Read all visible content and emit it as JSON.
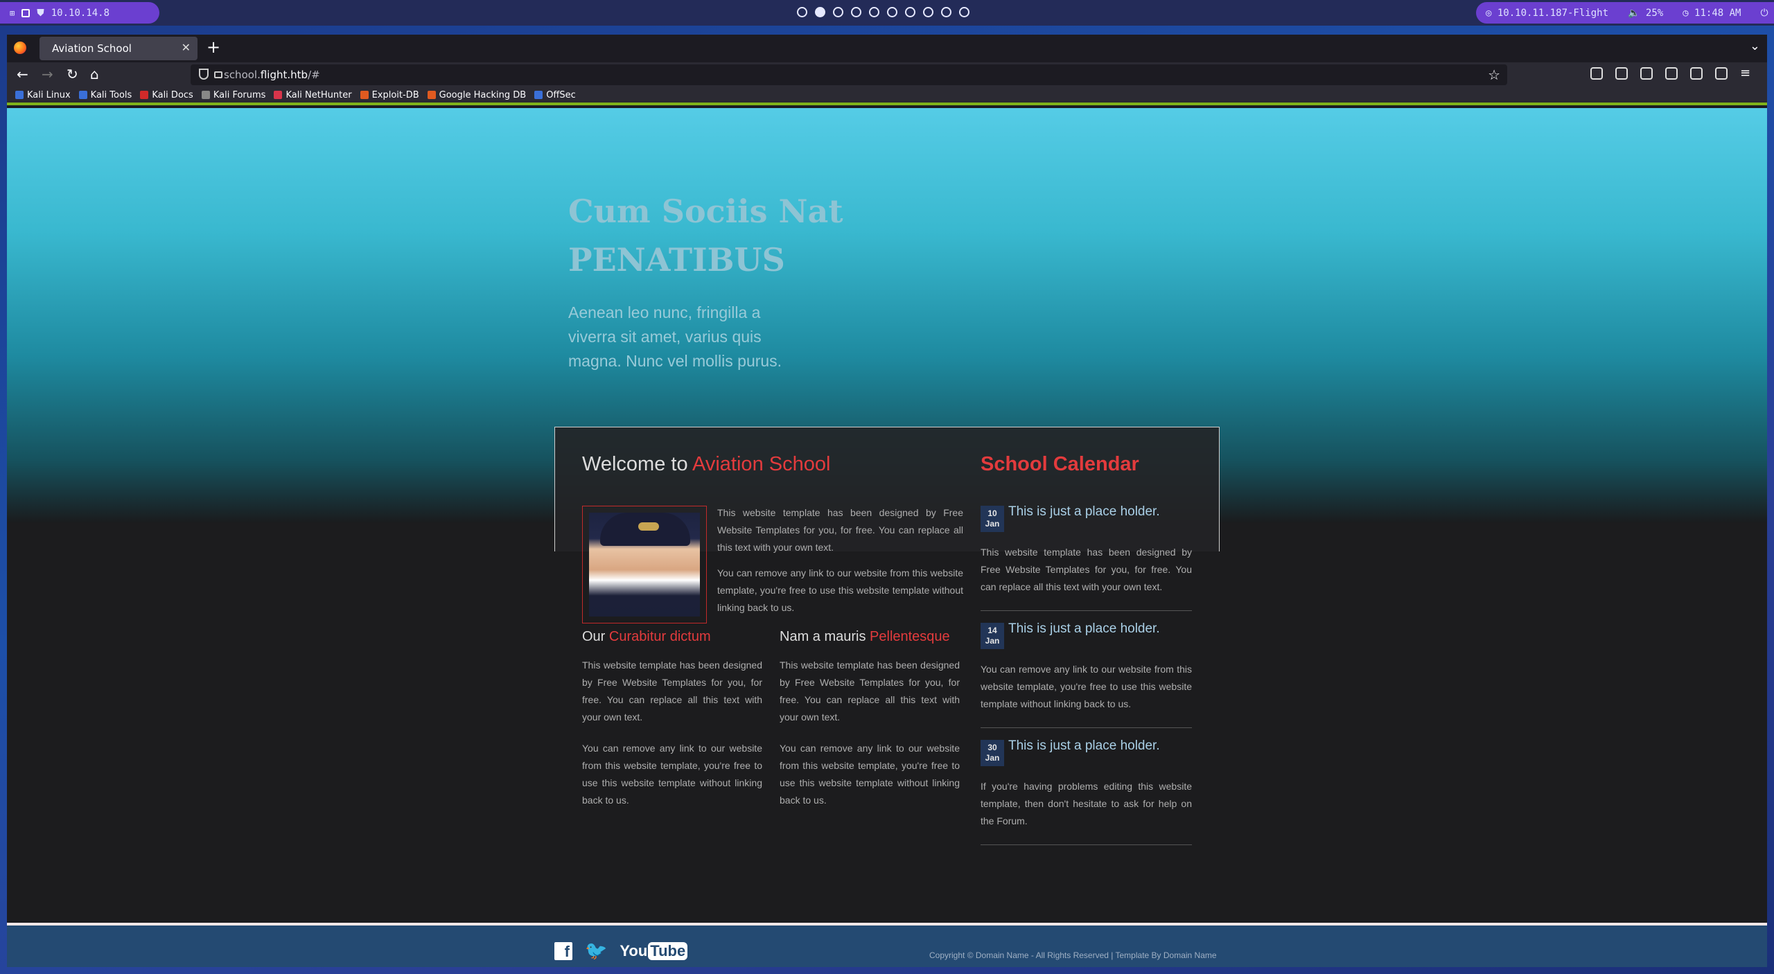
{
  "desktop": {
    "target_ip": "10.10.14.8",
    "remote_target": "10.10.11.187-Flight",
    "volume": "25%",
    "clock": "11:48 AM",
    "workspaces": 10,
    "active_workspace": 2
  },
  "browser": {
    "tab_title": "Aviation School",
    "url_prefix": "school.",
    "url_host": "flight.htb",
    "url_suffix": "/#",
    "bookmarks": [
      "Kali Linux",
      "Kali Tools",
      "Kali Docs",
      "Kali Forums",
      "Kali NetHunter",
      "Exploit-DB",
      "Google Hacking DB",
      "OffSec"
    ],
    "bookmark_colors": [
      "#3a6fd8",
      "#3a6fd8",
      "#d02a2a",
      "#888888",
      "#d8344a",
      "#e05a20",
      "#e05a20",
      "#3a6fd8"
    ]
  },
  "hero": {
    "title_line1": "Cum Sociis Nat",
    "title_line2": "PENATIBUS",
    "subtitle": "Aenean leo nunc, fringilla a viverra sit amet, varius quis magna. Nunc vel mollis purus."
  },
  "welcome": {
    "prefix": "Welcome to ",
    "highlight": "Aviation School",
    "p1": "This website template has been designed by Free Website Templates for you, for free. You can replace all this text with your own text.",
    "p2": "You can remove any link to our website from this website template, you're free to use this website template without linking back to us."
  },
  "columns": [
    {
      "prefix": "Our ",
      "highlight": "Curabitur dictum",
      "p1": "This website template has been designed by Free Website Templates for you, for free. You can replace all this text with your own text.",
      "p2": "You can remove any link to our website from this website template, you're free to use this website template without linking back to us."
    },
    {
      "prefix": "Nam a mauris ",
      "highlight": "Pellentesque",
      "p1": "This website template has been designed by Free Website Templates for you, for free. You can replace all this text with your own text.",
      "p2": "You can remove any link to our website from this website template, you're free to use this website template without linking back to us."
    }
  ],
  "calendar": {
    "heading": "School Calendar",
    "events": [
      {
        "day": "10",
        "month": "Jan",
        "title": "This is just a place holder.",
        "text": "This website template has been designed by Free Website Templates for you, for free. You can replace all this text with your own text."
      },
      {
        "day": "14",
        "month": "Jan",
        "title": "This is just a place holder.",
        "text": "You can remove any link to our website from this website template, you're free to use this website template without linking back to us."
      },
      {
        "day": "30",
        "month": "Jan",
        "title": "This is just a place holder.",
        "text": "If you're having problems editing this website template, then don't hesitate to ask for help on the Forum."
      }
    ]
  },
  "footer": {
    "facebook": "f",
    "twitter": "🐦",
    "youtube_you": "You",
    "youtube_tube": "Tube",
    "copyright": "Copyright © Domain Name - All Rights Reserved | Template By Domain Name"
  }
}
